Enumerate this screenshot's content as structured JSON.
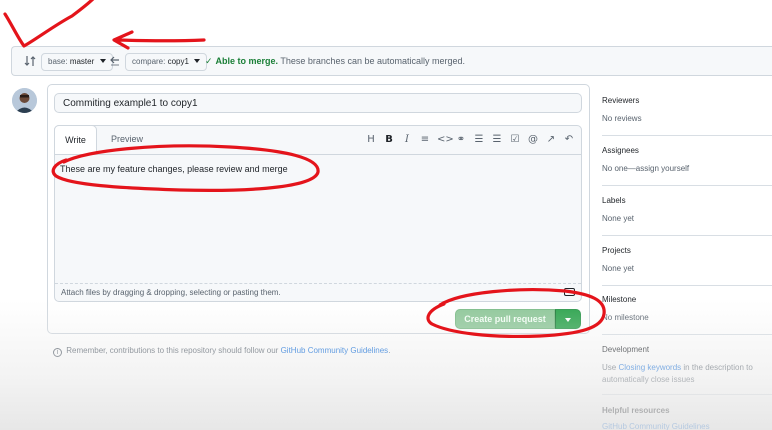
{
  "compare": {
    "base_label": "base:",
    "base_value": "master",
    "compare_label": "compare:",
    "compare_value": "copy1",
    "status_check": "✓",
    "status_able": "Able to merge.",
    "status_text": "These branches can be automatically merged."
  },
  "form": {
    "title_value": "Commiting example1 to copy1",
    "tab_write": "Write",
    "tab_preview": "Preview",
    "toolbar": [
      "H",
      "B",
      "I",
      "≡",
      "<>",
      "⚭",
      "☰",
      "☰",
      "☑",
      "@",
      "↗",
      "↶"
    ],
    "body_text": "These are my feature changes, please review and merge",
    "attach_text": "Attach files by dragging & dropping, selecting or pasting them.",
    "create_button": "Create pull request"
  },
  "notice": {
    "text": "Remember, contributions to this repository should follow our",
    "link": "GitHub Community Guidelines",
    "end": "."
  },
  "sidebar": {
    "reviewers_heading": "Reviewers",
    "reviewers_value": "No reviews",
    "assignees_heading": "Assignees",
    "assignees_value": "No one—assign yourself",
    "labels_heading": "Labels",
    "labels_value": "None yet",
    "projects_heading": "Projects",
    "projects_value": "None yet",
    "milestone_heading": "Milestone",
    "milestone_value": "No milestone",
    "development_heading": "Development",
    "development_pre": "Use",
    "development_link": "Closing keywords",
    "development_post": "in the description to automatically close issues",
    "helpful_heading": "Helpful resources",
    "helpful_link": "GitHub Community Guidelines"
  },
  "colors": {
    "accent_green": "#2da44e",
    "annotation_red": "#e4141b",
    "link_blue": "#0969da"
  }
}
